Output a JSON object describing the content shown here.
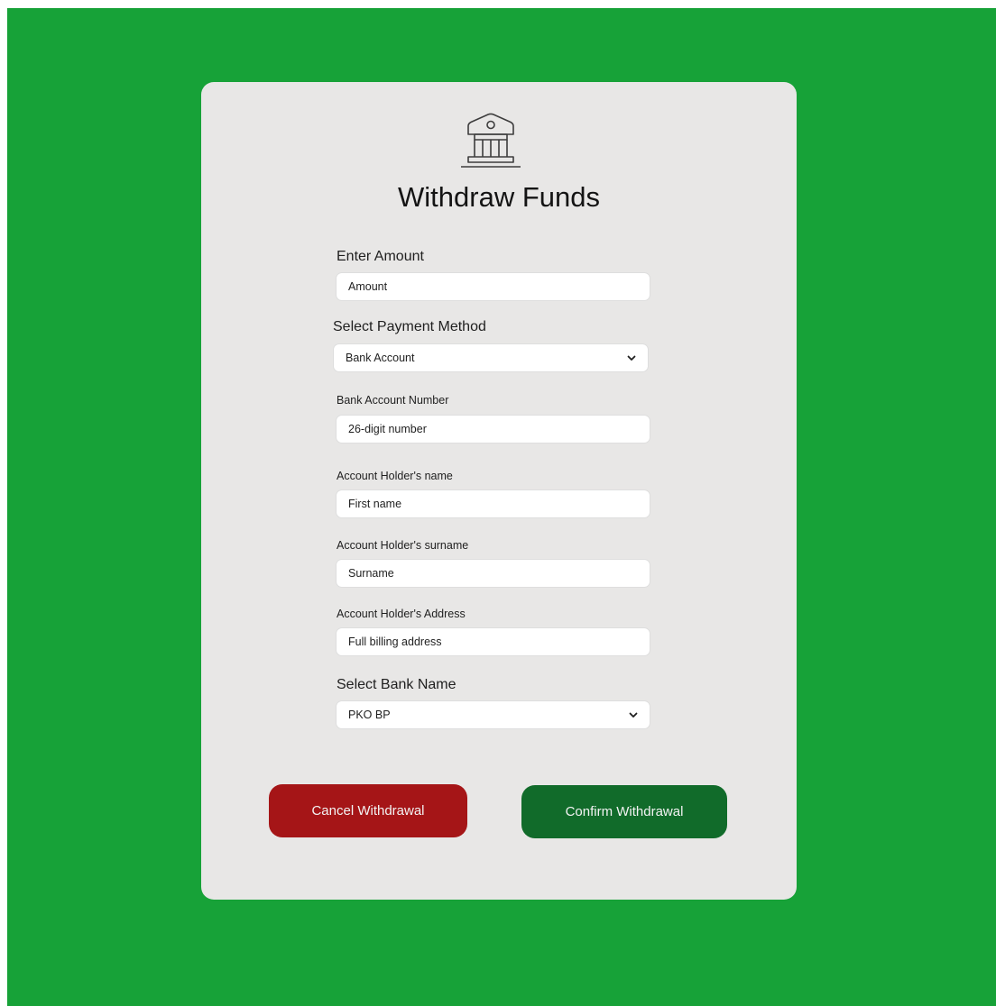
{
  "page": {
    "title": "Withdraw Funds",
    "icon": "bank-icon"
  },
  "form": {
    "amount": {
      "label": "Enter Amount",
      "placeholder": "Amount"
    },
    "payment_method": {
      "label": "Select Payment Method",
      "value": "Bank Account"
    },
    "account_number": {
      "label": "Bank Account Number",
      "placeholder": "26-digit number"
    },
    "holder_name": {
      "label": "Account Holder's name",
      "placeholder": "First name"
    },
    "holder_surname": {
      "label": "Account Holder's surname",
      "placeholder": "Surname"
    },
    "holder_address": {
      "label": "Account Holder's Address",
      "placeholder": "Full billing address"
    },
    "bank_name": {
      "label": "Select Bank Name",
      "value": "PKO BP"
    }
  },
  "actions": {
    "cancel_label": "Cancel Withdrawal",
    "confirm_label": "Confirm Withdrawal"
  },
  "colors": {
    "background": "#17a238",
    "card": "#e8e7e6",
    "cancel": "#a51517",
    "confirm": "#116b2a"
  }
}
